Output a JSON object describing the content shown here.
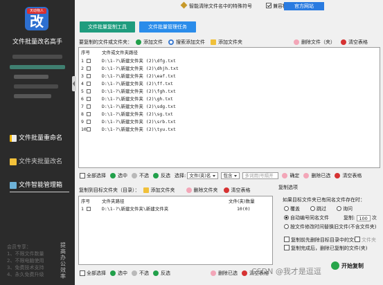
{
  "sidebar": {
    "logo_badge": "天动物人",
    "logo_char": "改",
    "app_name": "文件批量改名高手",
    "nav": [
      {
        "label": "文件批量重命名"
      },
      {
        "label": "文件夹批量改名"
      },
      {
        "label": "文件智能管理箱"
      }
    ],
    "member": [
      "会员专享：",
      "1、不限文件数量",
      "2、不限电脑使用",
      "3、免费技术支持",
      "4、永久免费升级"
    ],
    "vertical_text": "提高办公效率"
  },
  "header": {
    "special_chars_label": "智能清除文件名中的特殊符号",
    "compat_label": "兼容模式",
    "official_label": "官方网站"
  },
  "tabs": {
    "tool_label": "文件批量复制工具",
    "manage_label": "文件批量管理任务"
  },
  "source": {
    "toolbar_label": "要复制的文件或文件夹：",
    "add_file": "添加文件",
    "search_add": "搜索添加文件",
    "add_folder": "添加文件夹",
    "delete_file": "删除文件（夹）",
    "clear_table": "清空表格",
    "col_no": "序号",
    "col_path": "文件或文件夹路径",
    "rows": [
      {
        "no": "1",
        "path": "D:\\1-?\\新建文件夹 (2)\\dfg.txt"
      },
      {
        "no": "2",
        "path": "D:\\1-?\\新建文件夹 (2)\\dhjh.txt"
      },
      {
        "no": "3",
        "path": "D:\\1-?\\新建文件夹 (2)\\eaf.txt"
      },
      {
        "no": "4",
        "path": "D:\\1-?\\新建文件夹 (2)\\ff.txt"
      },
      {
        "no": "5",
        "path": "D:\\1-?\\新建文件夹 (2)\\fgh.txt"
      },
      {
        "no": "6",
        "path": "D:\\1-?\\新建文件夹 (2)\\gh.txt"
      },
      {
        "no": "7",
        "path": "D:\\1-?\\新建文件夹 (2)\\sdg.txt"
      },
      {
        "no": "8",
        "path": "D:\\1-?\\新建文件夹 (2)\\sg.txt"
      },
      {
        "no": "9",
        "path": "D:\\1-?\\新建文件夹 (2)\\srb.txt"
      },
      {
        "no": "10",
        "path": "D:\\1-?\\新建文件夹 (2)\\tyu.txt"
      }
    ]
  },
  "filter": {
    "select_all": "全部选择",
    "check": "选中",
    "uncheck": "不选",
    "invert": "反选",
    "select_label": "选择:",
    "field": "文件(夹)名",
    "match": "包含",
    "placeholder": "多词用|号隔开",
    "confirm": "确定",
    "delete_selected": "删除已选",
    "clear_table": "清空表格"
  },
  "target": {
    "toolbar_label": "复制到目标文件夹（目录）：",
    "add_folder": "添加文件夹",
    "delete_folder": "删除文件夹",
    "clear_table": "清空表格",
    "col_no": "序号",
    "col_path": "文件夹路径",
    "col_count": "文件(夹)数量",
    "rows": [
      {
        "no": "1",
        "path": "D:\\1-?\\新建文件夹\\新建文件夹",
        "count": "10(0)"
      }
    ]
  },
  "options": {
    "title": "复制选项",
    "question": "如果目标文件夹已有同名文件存在时：",
    "overwrite": "覆盖",
    "skip": "跳过",
    "ask": "询问",
    "auto_rename": "自动编号同名文件",
    "copies_label": "复制:",
    "copies": "100",
    "copies_unit": "次",
    "by_time": "按文件修改时间替换旧文件(不含文件夹)",
    "delete_before": "复制前先删除目标目录中的文件",
    "delete_before_extra": "文件夹",
    "delete_after": "复制完成后，删除已复制的文件(夹)"
  },
  "bottom": {
    "select_all": "全部选择",
    "check": "选中",
    "uncheck": "不选",
    "invert": "反选",
    "delete_selected": "删除已选",
    "clear_table": "清空表格"
  },
  "start_label": "开始复制",
  "watermark": "CSDN @我才是逗逗"
}
